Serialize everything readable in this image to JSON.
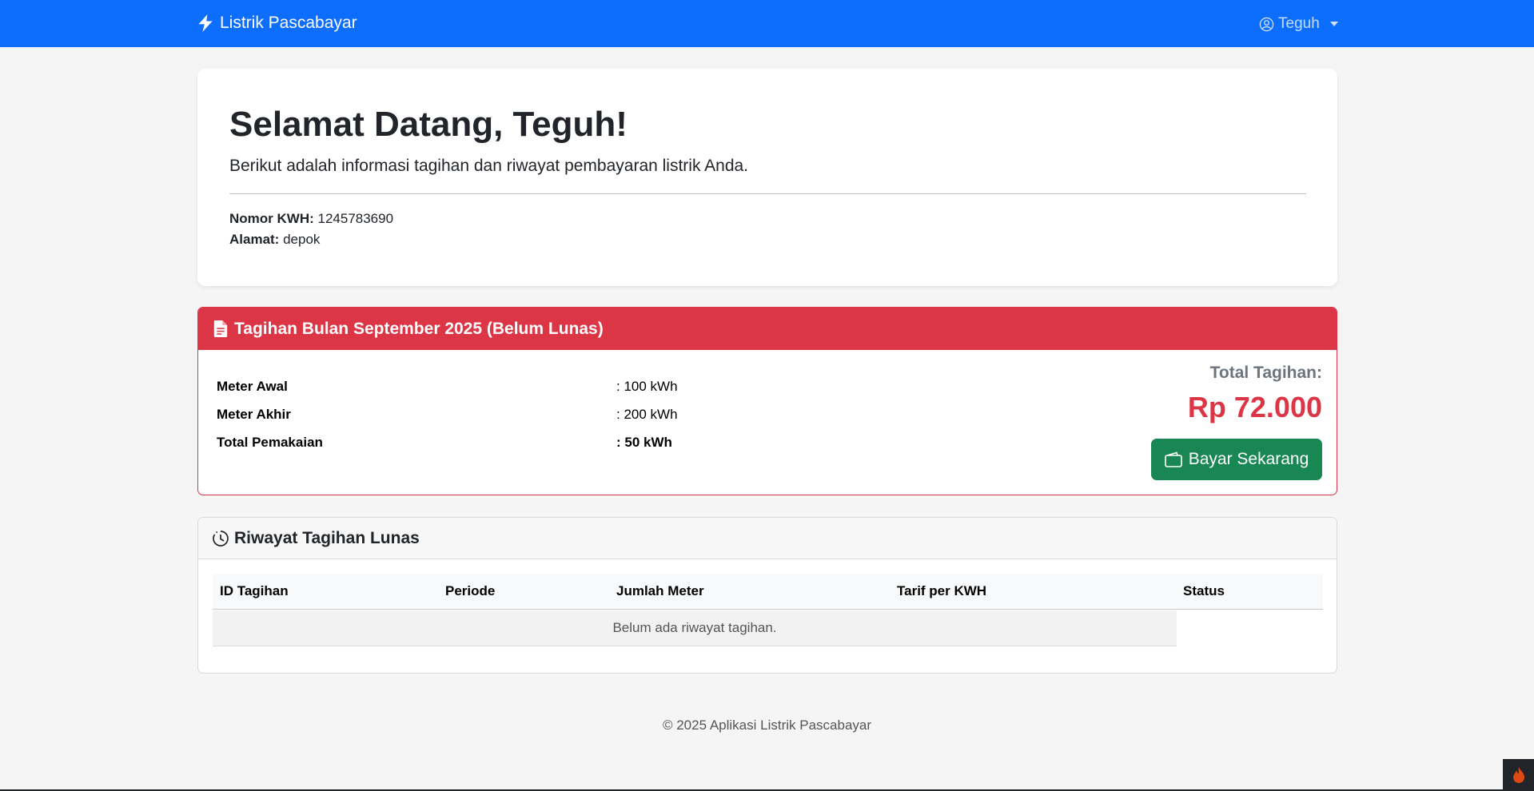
{
  "navbar": {
    "brand": "Listrik Pascabayar",
    "user_name": "Teguh"
  },
  "welcome": {
    "title": "Selamat Datang, Teguh!",
    "lead": "Berikut adalah informasi tagihan dan riwayat pembayaran listrik Anda.",
    "kwh_label": "Nomor KWH:",
    "kwh_value": "1245783690",
    "address_label": "Alamat:",
    "address_value": "depok"
  },
  "bill": {
    "header": "Tagihan Bulan September 2025 (Belum Lunas)",
    "rows": [
      {
        "label": "Meter Awal",
        "value": ": 100 kWh"
      },
      {
        "label": "Meter Akhir",
        "value": ": 200 kWh"
      },
      {
        "label": "Total Pemakaian",
        "value": ": 50 kWh"
      }
    ],
    "total_label": "Total Tagihan:",
    "total_amount": "Rp 72.000",
    "pay_button": "Bayar Sekarang"
  },
  "history": {
    "header": "Riwayat Tagihan Lunas",
    "columns": [
      "ID Tagihan",
      "Periode",
      "Jumlah Meter",
      "Tarif per KWH",
      "Status"
    ],
    "empty_message": "Belum ada riwayat tagihan."
  },
  "footer": "© 2025 Aplikasi Listrik Pascabayar",
  "colors": {
    "primary": "#0d6efd",
    "danger": "#dc3545",
    "success": "#198754"
  },
  "icons": {
    "brand": "lightning-icon",
    "user": "user-circle-icon",
    "bill": "document-icon",
    "pay": "wallet-icon",
    "history": "clock-history-icon",
    "debug": "flame-icon"
  }
}
